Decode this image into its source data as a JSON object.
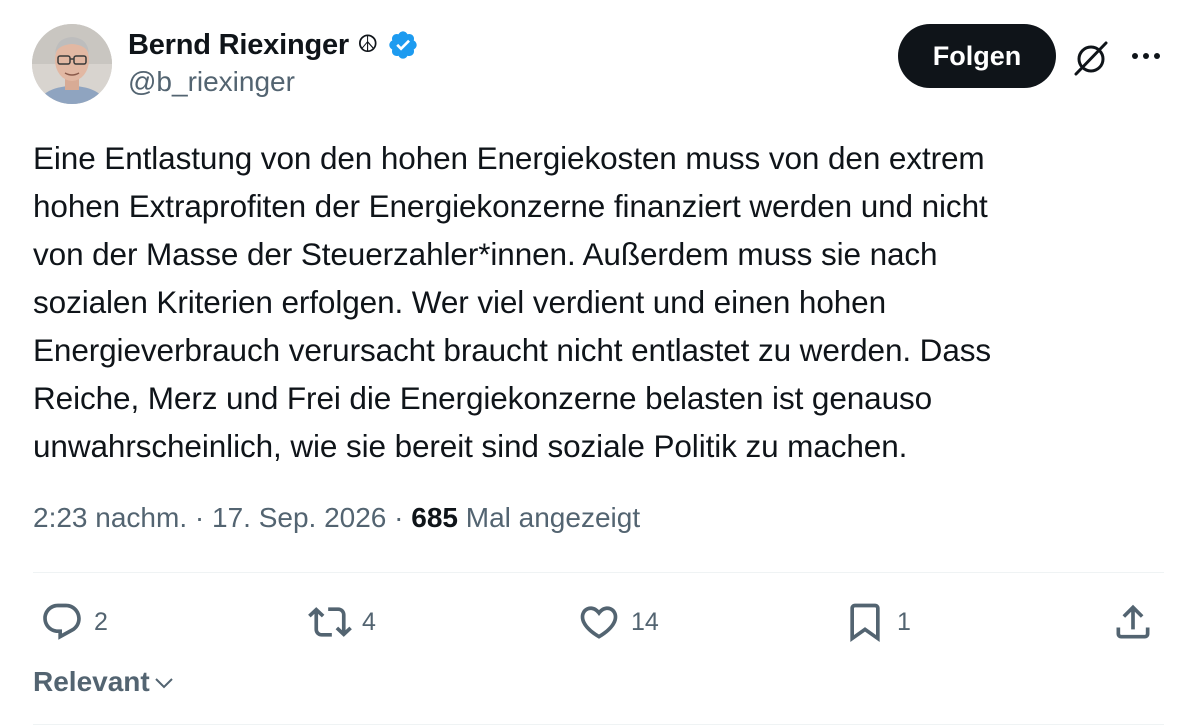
{
  "author": {
    "name": "Bernd Riexinger",
    "badge_emoji": "☮",
    "handle": "@b_riexinger",
    "verified_color": "#1d9bf0"
  },
  "follow_button": {
    "label": "Folgen"
  },
  "icons": {
    "grok": "grok-icon",
    "more": "more-icon",
    "reply": "reply-icon",
    "retweet": "retweet-icon",
    "like": "heart-icon",
    "bookmark": "bookmark-icon",
    "share": "share-icon",
    "chevron": "chevron-down-icon"
  },
  "tweet": {
    "text": "Eine Entlastung von den hohen Energiekosten muss von den extrem\nhohen Extraprofiten der Energiekonzerne finanziert werden und nicht\nvon der Masse der Steuerzahler*innen. Außerdem muss sie nach\nsozialen Kriterien erfolgen. Wer viel verdient und einen hohen\nEnergieverbrauch verursacht braucht nicht entlastet zu werden. Dass\nReiche, Merz und Frei die Energiekonzerne belasten ist genauso\nunwahrscheinlich, wie sie bereit sind soziale Politik zu machen."
  },
  "meta": {
    "time": "2:23 nachm.",
    "separator": " · ",
    "date": "17. Sep. 2026",
    "views_count": "685",
    "views_label": " Mal angezeigt"
  },
  "actions": {
    "replies": "2",
    "retweets": "4",
    "likes": "14",
    "bookmarks": "1"
  },
  "sort": {
    "label": "Relevant"
  },
  "colors": {
    "text": "#0f1419",
    "muted": "#536471",
    "divider": "#eff3f4",
    "button_bg": "#0f1419"
  }
}
